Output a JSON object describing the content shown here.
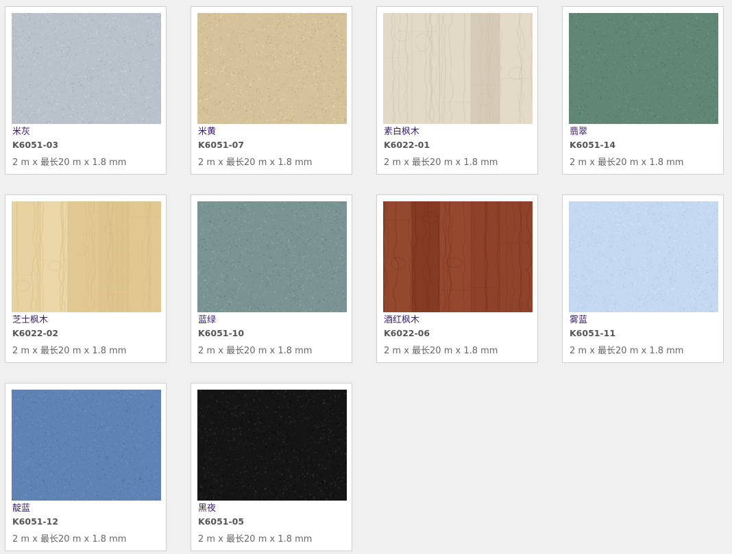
{
  "products": [
    {
      "name": "米灰",
      "code": "K6051-03",
      "spec": "2 m x 最长20 m x 1.8 mm",
      "pattern": "speckle",
      "base": "#b9c1cb",
      "dark": "#a3acb8",
      "light": "#d0d6dd"
    },
    {
      "name": "米黄",
      "code": "K6051-07",
      "spec": "2 m x 最长20 m x 1.8 mm",
      "pattern": "speckle",
      "base": "#d6c29a",
      "dark": "#bfa77a",
      "light": "#e8d9b8"
    },
    {
      "name": "素白枫木",
      "code": "K6022-01",
      "spec": "2 m x 最长20 m x 1.8 mm",
      "pattern": "wood",
      "base": "#ddd3bf",
      "dark": "#c9bda3",
      "light": "#ebe4d6"
    },
    {
      "name": "翡翠",
      "code": "K6051-14",
      "spec": "2 m x 最长20 m x 1.8 mm",
      "pattern": "speckle",
      "base": "#5f8774",
      "dark": "#4c7462",
      "light": "#749a88"
    },
    {
      "name": "芝士枫木",
      "code": "K6022-02",
      "spec": "2 m x 最长20 m x 1.8 mm",
      "pattern": "wood",
      "base": "#e6cf9c",
      "dark": "#d4b57a",
      "light": "#f1e0b8"
    },
    {
      "name": "蓝绿",
      "code": "K6051-10",
      "spec": "2 m x 最长20 m x 1.8 mm",
      "pattern": "speckle",
      "base": "#7a9494",
      "dark": "#627b7c",
      "light": "#94acac"
    },
    {
      "name": "酒红枫木",
      "code": "K6022-06",
      "spec": "2 m x 最长20 m x 1.8 mm",
      "pattern": "wood",
      "base": "#8a3e26",
      "dark": "#6e2c18",
      "light": "#a3553a"
    },
    {
      "name": "雾蓝",
      "code": "K6051-11",
      "spec": "2 m x 最长20 m x 1.8 mm",
      "pattern": "speckle",
      "base": "#c5d8f1",
      "dark": "#afc5e4",
      "light": "#dbe7f8"
    },
    {
      "name": "靛蓝",
      "code": "K6051-12",
      "spec": "2 m x 最长20 m x 1.8 mm",
      "pattern": "speckle",
      "base": "#5f83b5",
      "dark": "#4d6fa0",
      "light": "#7896c4"
    },
    {
      "name": "黑夜",
      "code": "K6051-05",
      "spec": "2 m x 最长20 m x 1.8 mm",
      "pattern": "speckle",
      "base": "#151515",
      "dark": "#070707",
      "light": "#3a3a3a"
    }
  ]
}
